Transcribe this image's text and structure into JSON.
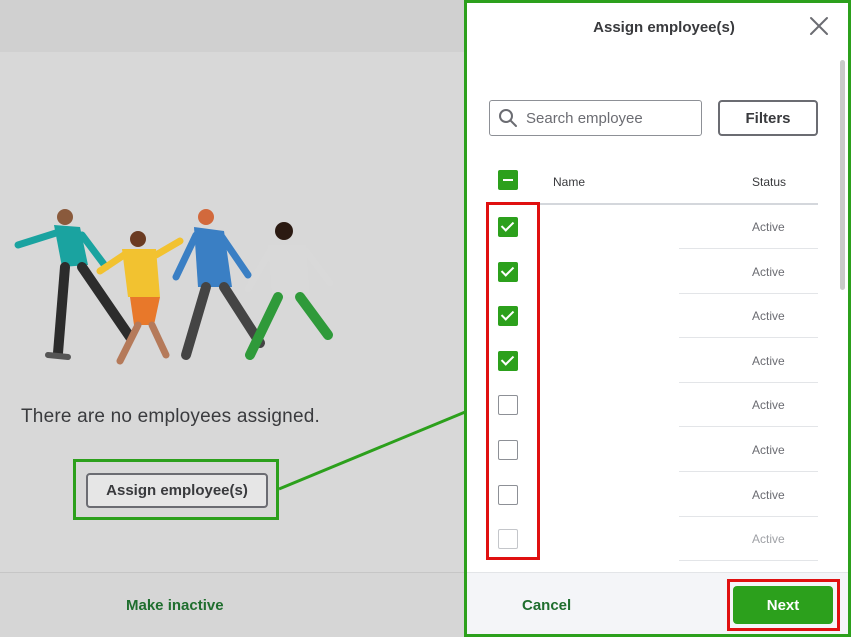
{
  "background": {
    "empty_message": "There are no employees assigned.",
    "assign_button_label": "Assign employee(s)",
    "footer_action": "Make inactive"
  },
  "panel": {
    "title": "Assign employee(s)",
    "close_icon": "close-icon",
    "search": {
      "placeholder": "Search employee",
      "value": "",
      "icon": "search-icon"
    },
    "filters_label": "Filters",
    "table": {
      "header_checkbox_state": "indeterminate",
      "columns": [
        "Name",
        "Status"
      ],
      "rows": [
        {
          "name": "",
          "status": "Active",
          "checked": true
        },
        {
          "name": "",
          "status": "Active",
          "checked": true
        },
        {
          "name": "",
          "status": "Active",
          "checked": true
        },
        {
          "name": "",
          "status": "Active",
          "checked": true
        },
        {
          "name": "",
          "status": "Active",
          "checked": false
        },
        {
          "name": "",
          "status": "Active",
          "checked": false
        },
        {
          "name": "",
          "status": "Active",
          "checked": false
        },
        {
          "name": "",
          "status": "Active",
          "checked": false
        }
      ]
    },
    "cancel_label": "Cancel",
    "next_label": "Next"
  },
  "colors": {
    "brand_green": "#2ca01c",
    "dark_green_text": "#1f6e2e",
    "highlight_red": "#e01010",
    "highlight_green": "#2ca01c"
  }
}
